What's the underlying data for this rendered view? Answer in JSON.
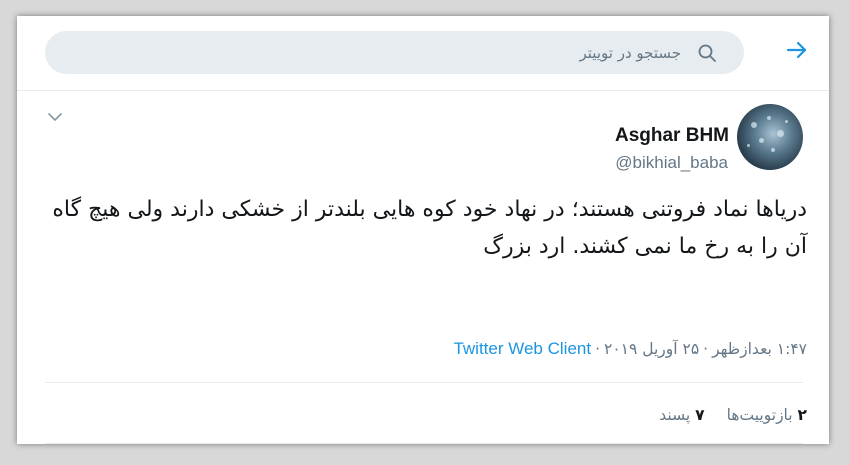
{
  "search": {
    "placeholder": "جستجو در توییتر"
  },
  "icons": {
    "back": "arrow-right-icon",
    "search": "search-icon",
    "menu": "chevron-down-icon"
  },
  "colors": {
    "accent": "#1b95e0",
    "search_bg": "#e6ecf0",
    "secondary_text": "#657786",
    "primary_text": "#14171a"
  },
  "tweet": {
    "display_name": "Asghar BHM",
    "handle": "@bikhial_baba",
    "text": "دریاها نماد فروتنی هستند؛ در نهاد خود کوه هایی بلندتر از خشکی دارند ولی هیچ گاه آن را به رخ ما نمی کشند. ارد بزرگ",
    "time": "۱:۴۷ بعدازظهر",
    "date": "۲۵ آوریل ۲۰۱۹",
    "separator": "·",
    "source": "Twitter Web Client",
    "retweets_count": "۲",
    "retweets_label": "بازتوییت‌ها",
    "likes_count": "۷",
    "likes_label": "پسند"
  }
}
